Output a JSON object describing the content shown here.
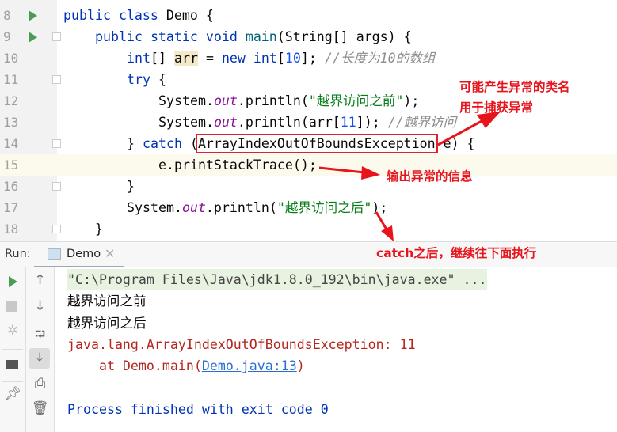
{
  "editor": {
    "lines": [
      {
        "n": "8",
        "parts": [
          [
            "kw",
            "public "
          ],
          [
            "kw",
            "class "
          ],
          [
            "",
            "Demo {"
          ]
        ]
      },
      {
        "n": "9",
        "parts": [
          [
            "kw",
            "public "
          ],
          [
            "kw",
            "static "
          ],
          [
            "kw",
            "void "
          ],
          [
            "fn",
            "main"
          ],
          [
            "",
            "(String[] args) {"
          ]
        ]
      },
      {
        "n": "10",
        "parts": [
          [
            "kw",
            "int"
          ],
          [
            "",
            "[] "
          ],
          [
            "hl",
            "arr"
          ],
          [
            "",
            " = "
          ],
          [
            "kw",
            "new "
          ],
          [
            "kw",
            "int"
          ],
          [
            "",
            "["
          ],
          [
            "num",
            "10"
          ],
          [
            "",
            "]; "
          ],
          [
            "cm",
            "//长度为10的数组"
          ]
        ]
      },
      {
        "n": "11",
        "parts": [
          [
            "kw",
            "try"
          ],
          [
            "",
            " {"
          ]
        ]
      },
      {
        "n": "12",
        "parts": [
          [
            "",
            "System."
          ],
          [
            "it",
            "out"
          ],
          [
            "",
            ".println("
          ],
          [
            "st",
            "\"越界访问之前\""
          ],
          [
            "",
            ");"
          ]
        ]
      },
      {
        "n": "13",
        "parts": [
          [
            "",
            "System."
          ],
          [
            "it",
            "out"
          ],
          [
            "",
            ".println(arr["
          ],
          [
            "num",
            "11"
          ],
          [
            "",
            "]); "
          ],
          [
            "cm",
            "//越界访问"
          ]
        ]
      },
      {
        "n": "14",
        "parts": [
          [
            "",
            "} "
          ],
          [
            "kw",
            "catch "
          ],
          [
            "",
            "("
          ],
          [
            "box",
            "ArrayIndexOutOfBoundsException"
          ],
          [
            "",
            " e) {"
          ]
        ]
      },
      {
        "n": "15",
        "parts": [
          [
            "",
            "e.printStackTrace();"
          ]
        ]
      },
      {
        "n": "16",
        "parts": [
          [
            "",
            "}"
          ]
        ]
      },
      {
        "n": "17",
        "parts": [
          [
            "",
            "System."
          ],
          [
            "it",
            "out"
          ],
          [
            "",
            ".println("
          ],
          [
            "st",
            "\"越界访问之后\""
          ],
          [
            "",
            ");"
          ]
        ]
      },
      {
        "n": "18",
        "parts": [
          [
            "",
            "}"
          ]
        ]
      }
    ]
  },
  "annotations": {
    "exception_class_1": "可能产生异常的类名",
    "exception_class_2": "用于捕获异常",
    "print_stack": "输出异常的信息",
    "after_catch": "catch之后，继续往下面执行"
  },
  "run_panel": {
    "label": "Run:",
    "tab": "Demo",
    "console": [
      {
        "cls": "cmd",
        "text": "\"C:\\Program Files\\Java\\jdk1.8.0_192\\bin\\java.exe\" ..."
      },
      {
        "cls": "out",
        "text": "越界访问之前"
      },
      {
        "cls": "out",
        "text": "越界访问之后"
      },
      {
        "cls": "err",
        "text": "java.lang.ArrayIndexOutOfBoundsException: 11"
      },
      {
        "cls": "trace",
        "text": "    at Demo.main(",
        "link": "Demo.java:13",
        "tail": ")"
      },
      {
        "cls": "out",
        "text": ""
      },
      {
        "cls": "fin",
        "text": "Process finished with exit code 0"
      }
    ]
  },
  "colors": {
    "annotation": "#e8141c",
    "keyword": "#0033b3",
    "string": "#067d17",
    "error": "#b3261e",
    "link": "#2a6ed1"
  }
}
